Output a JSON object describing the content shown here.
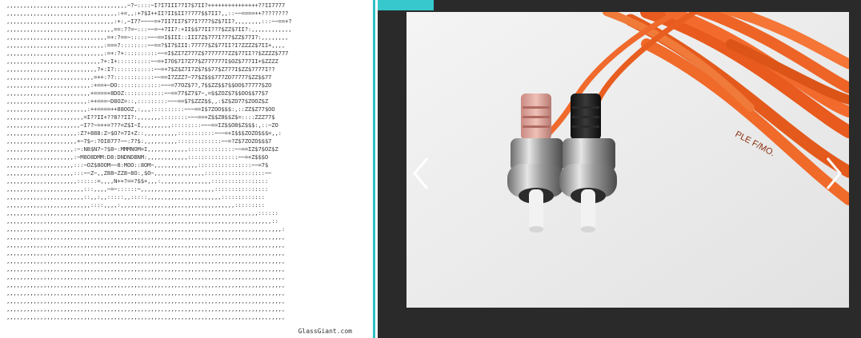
{
  "ascii": {
    "credit": "GlassGiant.com",
    "lines": [
      ",,,,,,,,,,,,,,,,,,,,,,,,,,,,,,,,,,,,~?~::::~I?I7III?7I7$7II?+++++++++++++++??II7777",
      ",,,,,,,,,,,,,,,,,,,,,,,,,,,,,,,,,:+=,,:+7$I++II?II$II??777$$7II?,,::~~====++????????",
      ",,,,,,,,,,,,,,,,,,,,,,,,,,,,,,,,:+:,~I7?~~~~=+7II7II7$77I?777$Z$7II?,,,,,,,,:::~~==+?",
      ",,,,,,,,,,,,,,,,,,,,,,,,,,,,,,,,==:??=~:::~~=~+7II?:+II$$77II??7$ZZ$7II?:,,,,,,,,,,,,",
      ",,,,,,,,,,,,,,,,,,,,,,,,,,,,,,=+:?==~:::::~~~==I$III::III7Z$777I?77$ZZ$77I?:,,,,,,,,",
      ",,,,,,,,,,,,,,,,,,,,,,,,,,,,,:===?::::::::~~==?$I7$III:77777$Z$77II?I?ZZZZ$7II+,,,,",
      ",,,,,,,,,,,,,,,,,,,,,,,,,,,,,:=+:?+::::::::::~~=I$ZI7Z777Z$7777777ZZ$77II??$ZZZZ$777",
      ",,,,,,,,,,,,,,,,,,,,,,,,,,,,?+:I+::::::::::~~=+I7O$7I7Z77$Z777777I$OZ$777II+$ZZZZ",
      ",,,,,,,,,,,,,,,,,,,,,,,,,,,?+:I?::::::::::::~~=+7$Z$Z7I7Z$7$$77$Z777I$ZZ$7777I??",
      ",,,,,,,,,,,,,,,,,,,,,,,,,,=++:??::::::::::::~~==I7ZZZ7~77$Z$$$777ZO77777$ZZ$$77",
      ",,,,,,,,,,,,,,,,,,,,,,,,,:+==+~DO:::::::::::::~~~=77OZ$7?,7$$ZZ$$7$$OO$77777$ZO",
      ",,,,,,,,,,,,,,,,,,,,,,,,,+====+8DOZ::::::::::::~~==77$Z7$7~,=$$ZOZ$7$$OO$$77$7",
      ",,,,,,,,,,,,,,,,,,,,,,,,:++===~D8OZ=::,:::::::::~~~==$7$ZZZ$$,,:$Z$ZO77$ZOOZ$Z",
      ",,,,,,,,,,,,,,,,,,,,,,,,:++====++88OOZ,:,,,::::::::::~~~==I$7ZOO$$$:,::ZZ$Z77$OO",
      ",,,,,,,,,,,,,,,,,,,,,,,=I??II+??8??II?:,,,,,,,::::::::~~~==+Z$$Z8$$Z$=::::ZZZ77$",
      ",,,,,,,,,,,,,,,,,,,,,,~I??~=++=???=Z$I~I,,,,,,,,,:::::::::~~~==IZ$$O8$Z$$$:,::~ZO",
      ",,,,,,,,,,,,,,,,,,,,,:Z?+888:Z~$O?=7I+Z::,,,,,,,,,,:::::::::::~~~=+I$$$ZOZO$$$=,,:",
      ",,,,,,,,,,,,,,,,,,,,,+~7$~:?OI877?~~:7?$:,,,,,,,,,,:::::::::::::~~=?Z$7ZOZO$$$7",
      ",,,,,,,,,,,,,,,,,,,,:~:N8$N7~?$8~:MMMNOM=I,,,,,,,,,,,,::::::::::::::~~==IZ$7$OZ$Z",
      ",,,,,,,,,,,,,,,,,,,,:~M8O8DMM:D8:DNDNDBNM:,,,,,,,,,,,,:::::::::::::::~~=+Z$$$O",
      ",,,,,,,,,,,,,,,,,,,,:::~OZ$8OOM~~8:MOO::8OM~,,,,,,,,,,,,,::::::::::::::::~~=7$",
      ",,,,,,,,,,,,,,,,,,,,:::~~Z~,,Z88~ZZ8~8O:,$O~,,,,,,,,,,,,,,,::::::::::::::::::~~",
      ",,,,,,,,,,,,,,,,,,,,,::::::=,,,,N++?==?$$+,,,:,,,,,,,,,,,,,,,:::::::::::::::::",
      ",,,,,,,,,,,,,,,,,,,,,,,:::,,,,~=~::::::~,,,,,,,,,,,,,,,,,,,,,,::::::::::::::::",
      ",,,,,,,,,,,,,,,,,,,,,,,::,,:,,:::::,,:::::,,,,,,,,,,,,,,,,,,,,,,:::::::::::::",
      ",,,,,,,,,,,,,,,,,,,,,,,,,::::,,,,:,,,,,,,,,,,,,,,,,,,,,,,,,,,,,,,,,,:::::::::",
      ",,,,,,,,,,,,,,,,,,,,,,,,,,,,,,,,,,,,,,,,,,,,,,,,,,,,,,,,,,,,,,,,,,,,,,,,,,,::::::",
      ",,,,,,,,,,,,,,,,,,,,,,,,,,,,,,,,,,,,,,,,,,,,,,,,,,,,,,,,,,,,,,,,,,,,,,,,,,,,,,,::",
      ",,,,,,,,,,,,,,,,,,,,,,,,,,,,,,,,,,,,,,,,,,,,,,,,,,,,,,,,,,,,,,,,,,,,,,,,,,,,,,,,,,:",
      ",,,,,,,,,,,,,,,,,,,,,,,,,,,,,,,,,,,,,,,,,,,,,,,,,,,,,,,,,,,,,,,,,,,,,,,,,,,,,,,,,,,",
      ",,,,,,,,,,,,,,,,,,,,,,,,,,,,,,,,,,,,,,,,,,,,,,,,,,,,,,,,,,,,,,,,,,,,,,,,,,,,,,,,,,,",
      ",,,,,,,,,,,,,,,,,,,,,,,,,,,,,,,,,,,,,,,,,,,,,,,,,,,,,,,,,,,,,,,,,,,,,,,,,,,,,,,,,,,",
      ",,,,,,,,,,,,,,,,,,,,,,,,,,,,,,,,,,,,,,,,,,,,,,,,,,,,,,,,,,,,,,,,,,,,,,,,,,,,,,,,,,,",
      ",,,,,,,,,,,,,,,,,,,,,,,,,,,,,,,,,,,,,,,,,,,,,,,,,,,,,,,,,,,,,,,,,,,,,,,,,,,,,,,,,,,",
      ",,,,,,,,,,,,,,,,,,,,,,,,,,,,,,,,,,,,,,,,,,,,,,,,,,,,,,,,,,,,,,,,,,,,,,,,,,,,,,,,,,,",
      ",,,,,,,,,,,,,,,,,,,,,,,,,,,,,,,,,,,,,,,,,,,,,,,,,,,,,,,,,,,,,,,,,,,,,,,,,,,,,,,,,,,",
      ",,,,,,,,,,,,,,,,,,,,,,,,,,,,,,,,,,,,,,,,,,,,,,,,,,,,,,,,,,,,,,,,,,,,,,,,,,,,,,,,,,,",
      ",,,,,,,,,,,,,,,,,,,,,,,,,,,,,,,,,,,,,,,,,,,,,,,,,,,,,,,,,,,,,,,,,,,,,,,,,,,,,,,,,,,",
      ",,,,,,,,,,,,,,,,,,,,,,,,,,,,,,,,,,,,,,,,,,,,,,,,,,,,,,,,,,,,,,,,,,,,,,,,,,,,,,,,,,,",
      ",,,,,,,,,,,,,,,,,,,,,,,,,,,,,,,,,,,,,,,,,,,,,,,,,,,,,,,,,,,,,,,,,,,,,,,,,,,,,,,,,,,"
    ]
  },
  "viewer": {
    "cable_print": "PLE F/MO.",
    "icons": {
      "prev": "chevron-left-icon",
      "next": "chevron-right-icon"
    },
    "colors": {
      "accent": "#36c8cc",
      "background": "#2a2a2a",
      "cable": "#f06a2a"
    }
  }
}
